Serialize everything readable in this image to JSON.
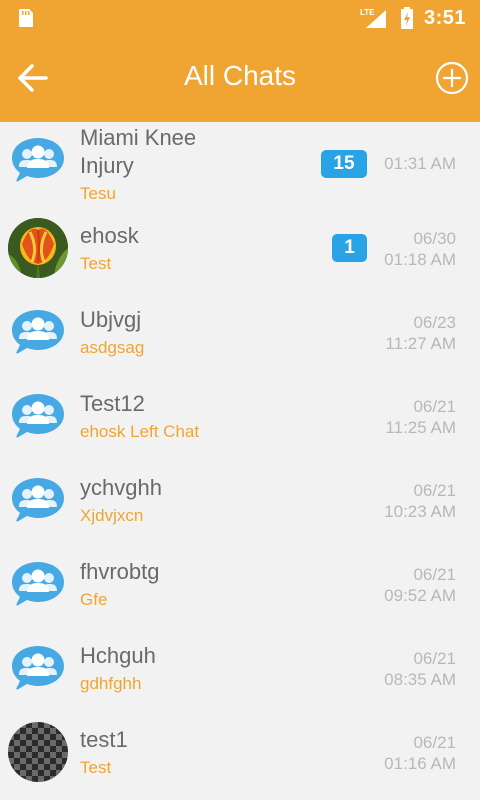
{
  "status_bar": {
    "network": "LTE",
    "time": "3:51"
  },
  "header": {
    "title": "All Chats",
    "back_icon": "arrow-left-icon",
    "add_icon": "plus-circle-icon"
  },
  "colors": {
    "accent": "#f0a532",
    "badge": "#29a3e6",
    "bubble": "#46a9e3",
    "muted": "#b8b8b8",
    "name": "#6a6a6a"
  },
  "chats": [
    {
      "name_line1": "Miami Knee",
      "name_line2": "Injury",
      "subtitle": "Tesu",
      "badge": "15",
      "date": "",
      "time": "01:31 AM",
      "avatar": "group-chat-icon"
    },
    {
      "name": "ehosk",
      "subtitle": "Test",
      "badge": "1",
      "date": "06/30",
      "time": "01:18 AM",
      "avatar": "tulip-photo"
    },
    {
      "name": "Ubjvgj",
      "subtitle": "asdgsag",
      "date": "06/23",
      "time": "11:27 AM",
      "avatar": "group-chat-icon"
    },
    {
      "name": "Test12",
      "subtitle": "ehosk Left Chat",
      "date": "06/21",
      "time": "11:25 AM",
      "avatar": "group-chat-icon"
    },
    {
      "name": "ychvghh",
      "subtitle": "Xjdvjxcn",
      "date": "06/21",
      "time": "10:23 AM",
      "avatar": "group-chat-icon"
    },
    {
      "name": "fhvrobtg",
      "subtitle": "Gfe",
      "date": "06/21",
      "time": "09:52 AM",
      "avatar": "group-chat-icon"
    },
    {
      "name": "Hchguh",
      "subtitle": "gdhfghh",
      "date": "06/21",
      "time": "08:35 AM",
      "avatar": "group-chat-icon"
    },
    {
      "name": "test1",
      "subtitle": "Test",
      "date": "06/21",
      "time": "01:16 AM",
      "avatar": "checkerboard-photo"
    }
  ]
}
